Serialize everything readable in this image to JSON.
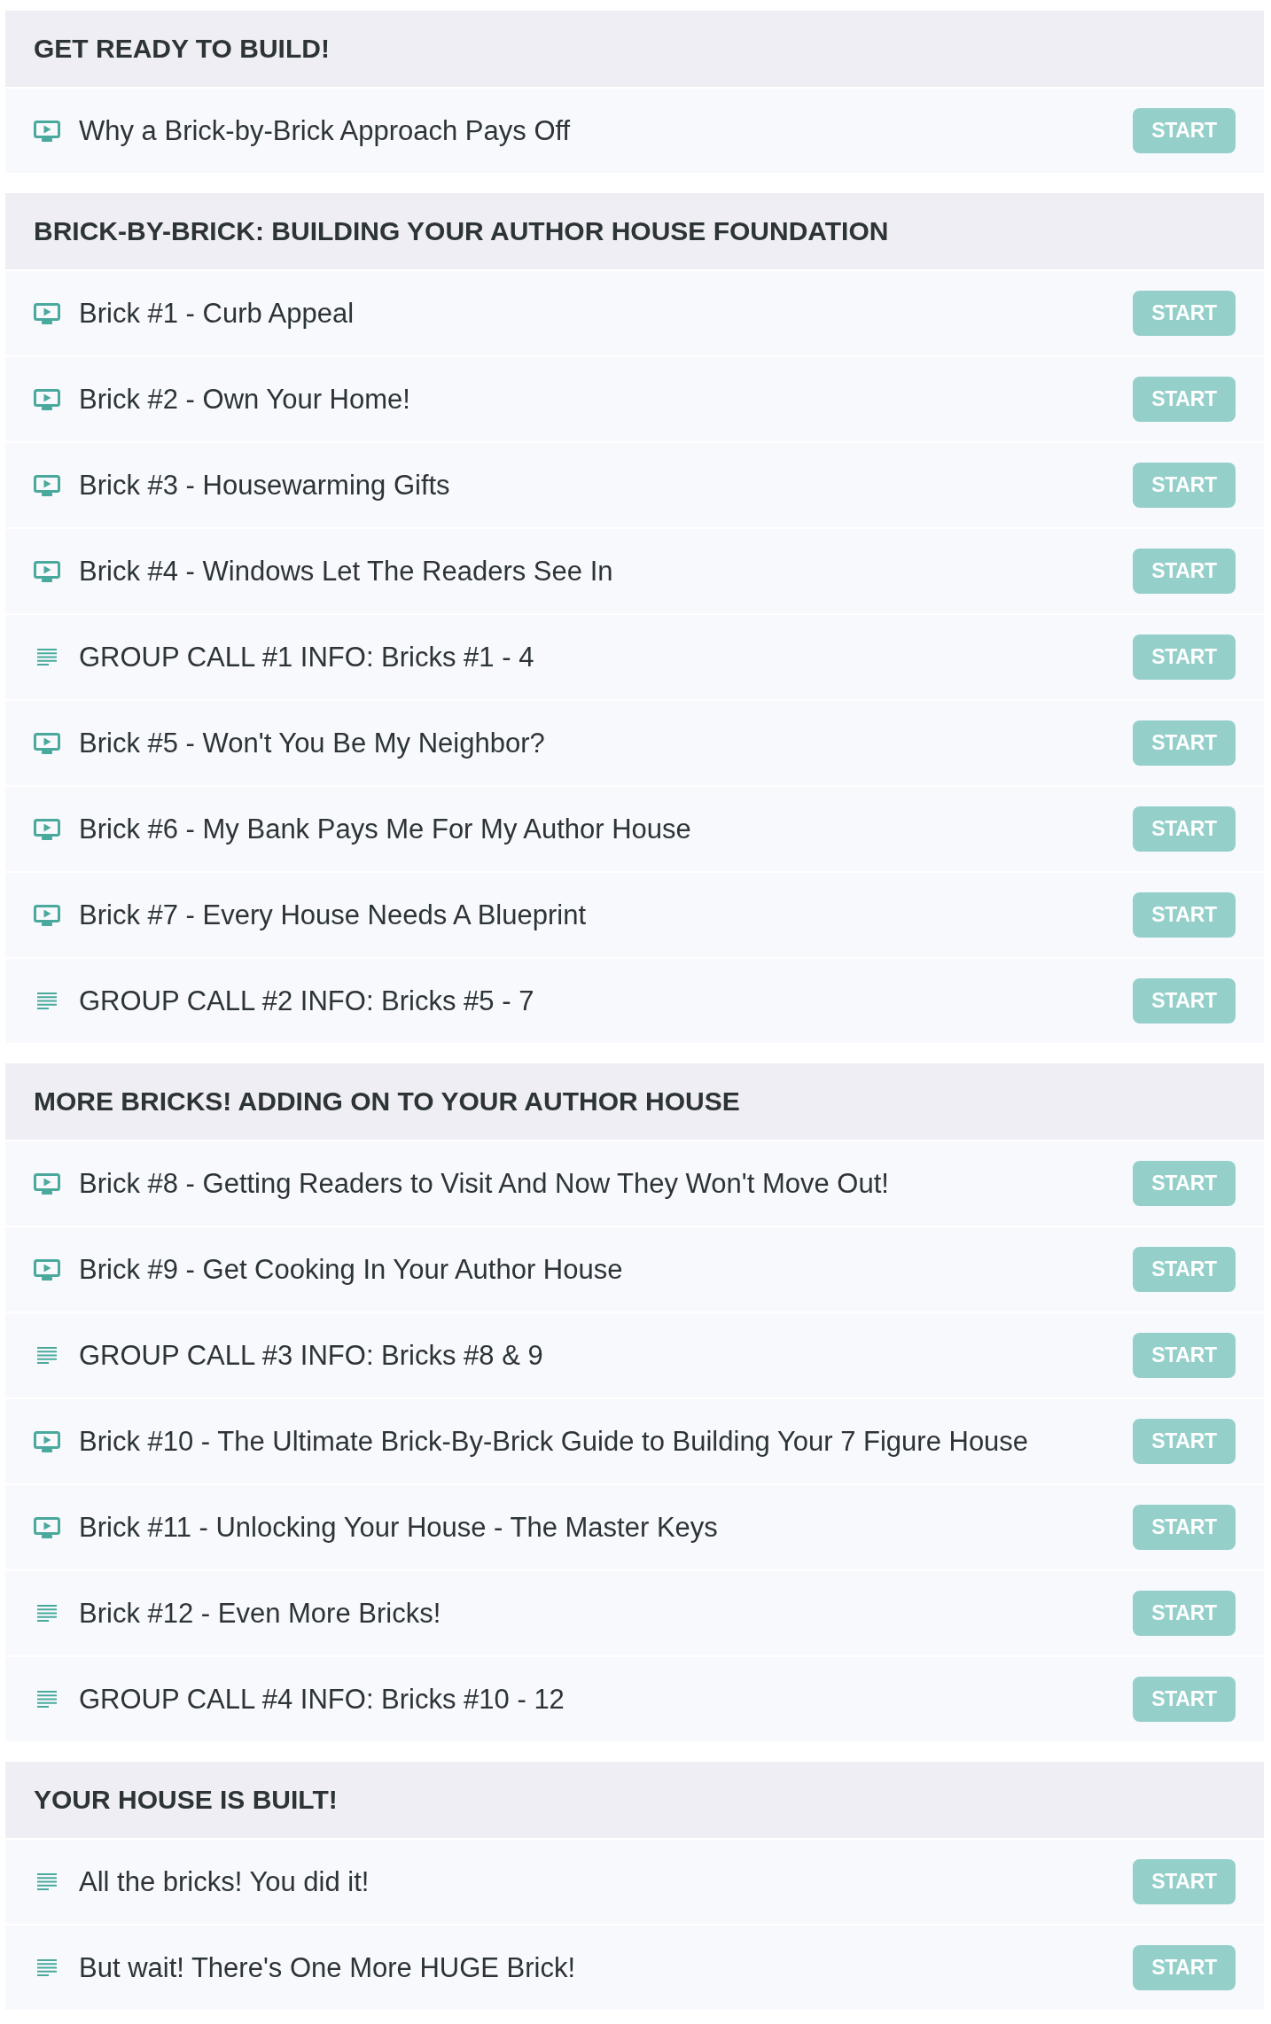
{
  "sections": [
    {
      "title": "GET READY TO BUILD!",
      "lessons": [
        {
          "kind": "video",
          "title": "Why a Brick-by-Brick Approach Pays Off",
          "action": "START"
        }
      ]
    },
    {
      "title": "BRICK-BY-BRICK: BUILDING YOUR AUTHOR HOUSE FOUNDATION",
      "lessons": [
        {
          "kind": "video",
          "title": "Brick #1 - Curb Appeal",
          "action": "START"
        },
        {
          "kind": "video",
          "title": "Brick #2 - Own Your Home!",
          "action": "START"
        },
        {
          "kind": "video",
          "title": "Brick #3 - Housewarming Gifts",
          "action": "START"
        },
        {
          "kind": "video",
          "title": "Brick #4 - Windows Let The Readers See In",
          "action": "START"
        },
        {
          "kind": "text",
          "title": "GROUP CALL #1 INFO: Bricks #1 - 4",
          "action": "START"
        },
        {
          "kind": "video",
          "title": "Brick #5 - Won't You Be My Neighbor?",
          "action": "START"
        },
        {
          "kind": "video",
          "title": "Brick #6 - My Bank Pays Me For My Author House",
          "action": "START"
        },
        {
          "kind": "video",
          "title": "Brick #7 - Every House Needs A Blueprint",
          "action": "START"
        },
        {
          "kind": "text",
          "title": "GROUP CALL #2 INFO: Bricks #5 - 7",
          "action": "START"
        }
      ]
    },
    {
      "title": "MORE BRICKS! ADDING ON TO YOUR AUTHOR HOUSE",
      "lessons": [
        {
          "kind": "video",
          "title": "Brick #8 - Getting Readers to Visit And Now They Won't Move Out!",
          "action": "START"
        },
        {
          "kind": "video",
          "title": "Brick #9 - Get Cooking In Your Author House",
          "action": "START"
        },
        {
          "kind": "text",
          "title": "GROUP CALL #3 INFO: Bricks #8 & 9",
          "action": "START"
        },
        {
          "kind": "video",
          "title": "Brick #10 - The Ultimate Brick-By-Brick Guide to Building Your 7 Figure House",
          "action": "START"
        },
        {
          "kind": "video",
          "title": "Brick #11 - Unlocking Your House - The Master Keys",
          "action": "START"
        },
        {
          "kind": "text",
          "title": "Brick #12 - Even More Bricks!",
          "action": "START"
        },
        {
          "kind": "text",
          "title": "GROUP CALL #4 INFO: Bricks #10 - 12",
          "action": "START"
        }
      ]
    },
    {
      "title": "YOUR HOUSE IS BUILT!",
      "lessons": [
        {
          "kind": "text",
          "title": "All the bricks! You did it!",
          "action": "START"
        },
        {
          "kind": "text",
          "title": "But wait! There's One More HUGE Brick!",
          "action": "START"
        }
      ]
    }
  ]
}
